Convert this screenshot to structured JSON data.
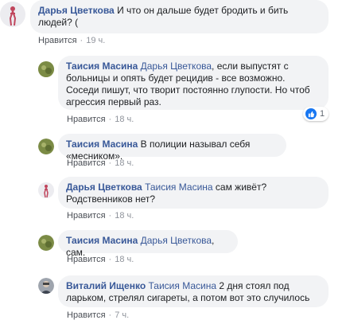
{
  "like_label": "Нравится",
  "comments": [
    {
      "author": "Дарья Цветкова",
      "mention": "",
      "text": "И что он дальше будет бродить и бить людей? (",
      "time": "19 ч."
    },
    {
      "author": "Таисия Масина",
      "mention": "Дарья Цветкова",
      "text": ", если выпустят с больницы и опять будет рецидив - все возможно. Соседи пишут, что творит постоянно глупости. Но чтоб агрессия первый раз.",
      "time": "18 ч.",
      "reactions": {
        "icon": "thumbs-up-icon",
        "count": "1"
      }
    },
    {
      "author": "Таисия Масина",
      "mention": "",
      "text": "В полиции называл себя «месником».",
      "time": "18 ч."
    },
    {
      "author": "Дарья Цветкова",
      "mention": "Таисия Масина",
      "text": " сам живёт? Родственников нет?",
      "time": "18 ч."
    },
    {
      "author": "Таисия Масина",
      "mention": "Дарья Цветкова",
      "text": ", сам.",
      "time": "18 ч."
    },
    {
      "author": "Виталий Ищенко",
      "mention": "Таисия Масина",
      "text": " 2 дня стоял под ларьком, стрелял сигареты, а потом вот это случилось",
      "time": "7 ч."
    }
  ],
  "colors": {
    "author": "#385898",
    "bubble": "#f2f3f5",
    "meta": "#90949c",
    "reaction": "#1877f2"
  }
}
